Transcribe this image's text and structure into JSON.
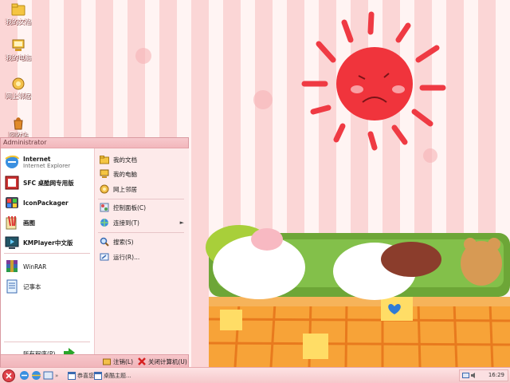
{
  "desktop": {
    "icons": [
      {
        "label": "我的文档",
        "icon": "folder-icon"
      },
      {
        "label": "我的电脑",
        "icon": "computer-icon"
      },
      {
        "label": "网上邻居",
        "icon": "network-icon"
      },
      {
        "label": "回收站",
        "icon": "recycle-bin-icon"
      }
    ]
  },
  "start_menu": {
    "user": "Administrator",
    "left_items": [
      {
        "title": "Internet",
        "subtitle": "Internet Explorer",
        "icon": "ie-icon"
      },
      {
        "title": "SFC 桌酷网专用版",
        "icon": "sfc-icon"
      },
      {
        "title": "IconPackager",
        "icon": "iconpackager-icon"
      },
      {
        "title": "画图",
        "icon": "paint-icon"
      },
      {
        "title": "KMPlayer中文版",
        "icon": "kmplayer-icon"
      },
      {
        "title": "WinRAR",
        "icon": "winrar-icon"
      },
      {
        "title": "记事本",
        "icon": "notepad-icon"
      }
    ],
    "all_programs": "所有程序(P)",
    "right_items": [
      {
        "label": "我的文档",
        "icon": "folder-icon"
      },
      {
        "label": "我的电脑",
        "icon": "computer-icon"
      },
      {
        "label": "网上邻居",
        "icon": "network-icon"
      },
      {
        "label": "控制面板(C)",
        "icon": "control-panel-icon"
      },
      {
        "label": "连接到(T)",
        "icon": "connect-icon",
        "submenu": "►"
      },
      {
        "label": "搜索(S)",
        "icon": "search-icon"
      },
      {
        "label": "运行(R)...",
        "icon": "run-icon"
      }
    ],
    "logoff": "注销(L)",
    "shutdown": "关闭计算机(U)"
  },
  "taskbar": {
    "overflow": "»",
    "tasks": [
      {
        "label": "恭喜您!",
        "icon": "window-icon"
      },
      {
        "label": "桌酷主题...",
        "icon": "window-icon"
      }
    ],
    "clock": "16:29"
  },
  "colors": {
    "accent": "#f2b7bc",
    "sun": "#f0343c"
  }
}
